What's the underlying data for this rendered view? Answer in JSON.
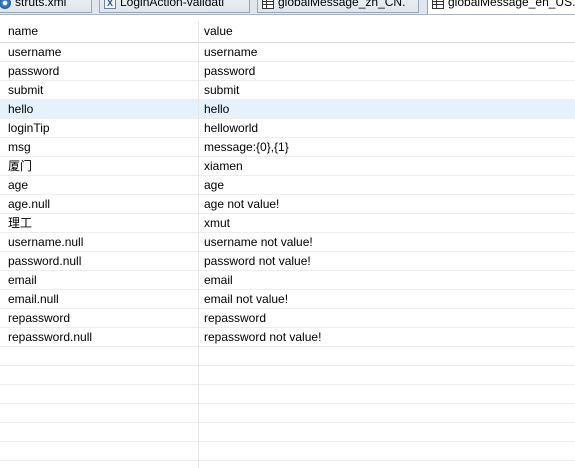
{
  "tabs": [
    {
      "label": "struts.xml",
      "icon": "gear-icon",
      "active": false
    },
    {
      "label": "LoginAction-validati",
      "icon": "xml-file-icon",
      "active": false
    },
    {
      "label": "globalMessage_zh_CN.",
      "icon": "properties-file-icon",
      "active": false
    },
    {
      "label": "globalMessage_en_US.",
      "icon": "properties-file-icon",
      "active": true
    }
  ],
  "table": {
    "headers": {
      "name": "name",
      "value": "value"
    },
    "selected_row": 3,
    "rows": [
      {
        "name": "username",
        "value": "username"
      },
      {
        "name": "password",
        "value": "password"
      },
      {
        "name": "submit",
        "value": "submit"
      },
      {
        "name": "hello",
        "value": "hello"
      },
      {
        "name": "loginTip",
        "value": "helloworld"
      },
      {
        "name": "msg",
        "value": "message:{0},{1}"
      },
      {
        "name": "厦门",
        "value": "xiamen"
      },
      {
        "name": "age",
        "value": "age"
      },
      {
        "name": "age.null",
        "value": "age not value!"
      },
      {
        "name": "理工",
        "value": "xmut"
      },
      {
        "name": "username.null",
        "value": "username not value!"
      },
      {
        "name": "password.null",
        "value": "password not value!"
      },
      {
        "name": "email",
        "value": "email"
      },
      {
        "name": "email.null",
        "value": "email not value!"
      },
      {
        "name": "repassword",
        "value": "repassword"
      },
      {
        "name": "repassword.null",
        "value": "repassword not value!"
      },
      {
        "name": "",
        "value": ""
      },
      {
        "name": "",
        "value": ""
      },
      {
        "name": "",
        "value": ""
      },
      {
        "name": "",
        "value": ""
      },
      {
        "name": "",
        "value": ""
      },
      {
        "name": "",
        "value": ""
      },
      {
        "name": "",
        "value": ""
      }
    ]
  },
  "colors": {
    "selected_row_bg": "#e5f1fb",
    "tab_bar_bg": "#dfe6ee"
  }
}
